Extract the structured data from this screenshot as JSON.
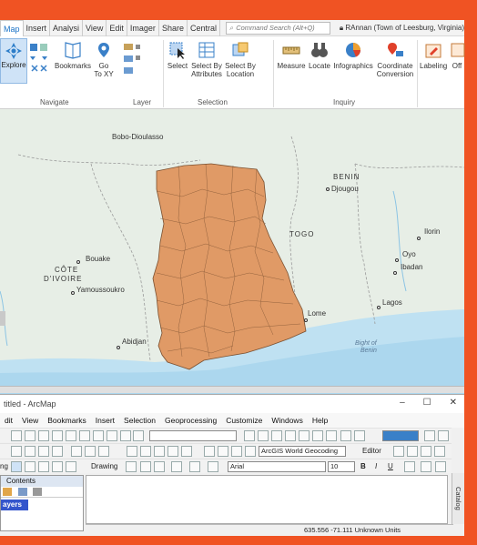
{
  "pro": {
    "tabs": [
      "Map",
      "Insert",
      "Analysi",
      "View",
      "Edit",
      "Imager",
      "Share",
      "Central"
    ],
    "command_search_placeholder": "Command Search (Alt+Q)",
    "user": "RAnnan (Town of Leesburg, Virginia)",
    "buttons": {
      "explore": "Explore",
      "bookmarks": "Bookmarks",
      "goto_xy_1": "Go",
      "goto_xy_2": "To XY",
      "select": "Select",
      "select_attr_1": "Select By",
      "select_attr_2": "Attributes",
      "select_loc_1": "Select By",
      "select_loc_2": "Location",
      "measure": "Measure",
      "locate": "Locate",
      "infographics": "Infographics",
      "coord_1": "Coordinate",
      "coord_2": "Conversion",
      "labeling": "Labeling",
      "off": "Off"
    },
    "groups": {
      "navigate": "Navigate",
      "layer": "Layer",
      "selection": "Selection",
      "inquiry": "Inquiry"
    }
  },
  "map": {
    "labels": {
      "bobo": "Bobo-Dioulasso",
      "benin": "BENIN",
      "djougou": "Djougou",
      "togo": "TOGO",
      "ilorin": "Ilorin",
      "oyo": "Oyo",
      "ibadan": "Ibadan",
      "bouake": "Bouake",
      "cote": "CÔTE",
      "divoire": "D'IVOIRE",
      "yamoussoukro": "Yamoussoukro",
      "abidjan": "Abidjan",
      "lome": "Lome",
      "lagos": "Lagos",
      "bight_1": "Bight of",
      "bight_2": "Benin"
    },
    "fill_color": "#e09a66"
  },
  "arcmap": {
    "title": "titled - ArcMap",
    "menu": [
      "dit",
      "View",
      "Bookmarks",
      "Insert",
      "Selection",
      "Geoprocessing",
      "Customize",
      "Windows",
      "Help"
    ],
    "geocoder": "ArcGIS World Geocoding",
    "editor": "Editor",
    "drawing": "Drawing",
    "font": "Arial",
    "font_size": "10",
    "bold": "B",
    "italic": "I",
    "underline": "U",
    "contents": "Contents",
    "layers": "ayers",
    "catalog": "Catalog",
    "coords": "635.556  -71.111 Unknown Units",
    "status_left": "ng",
    "win_min": "–",
    "win_max": "☐",
    "win_close": "✕"
  }
}
